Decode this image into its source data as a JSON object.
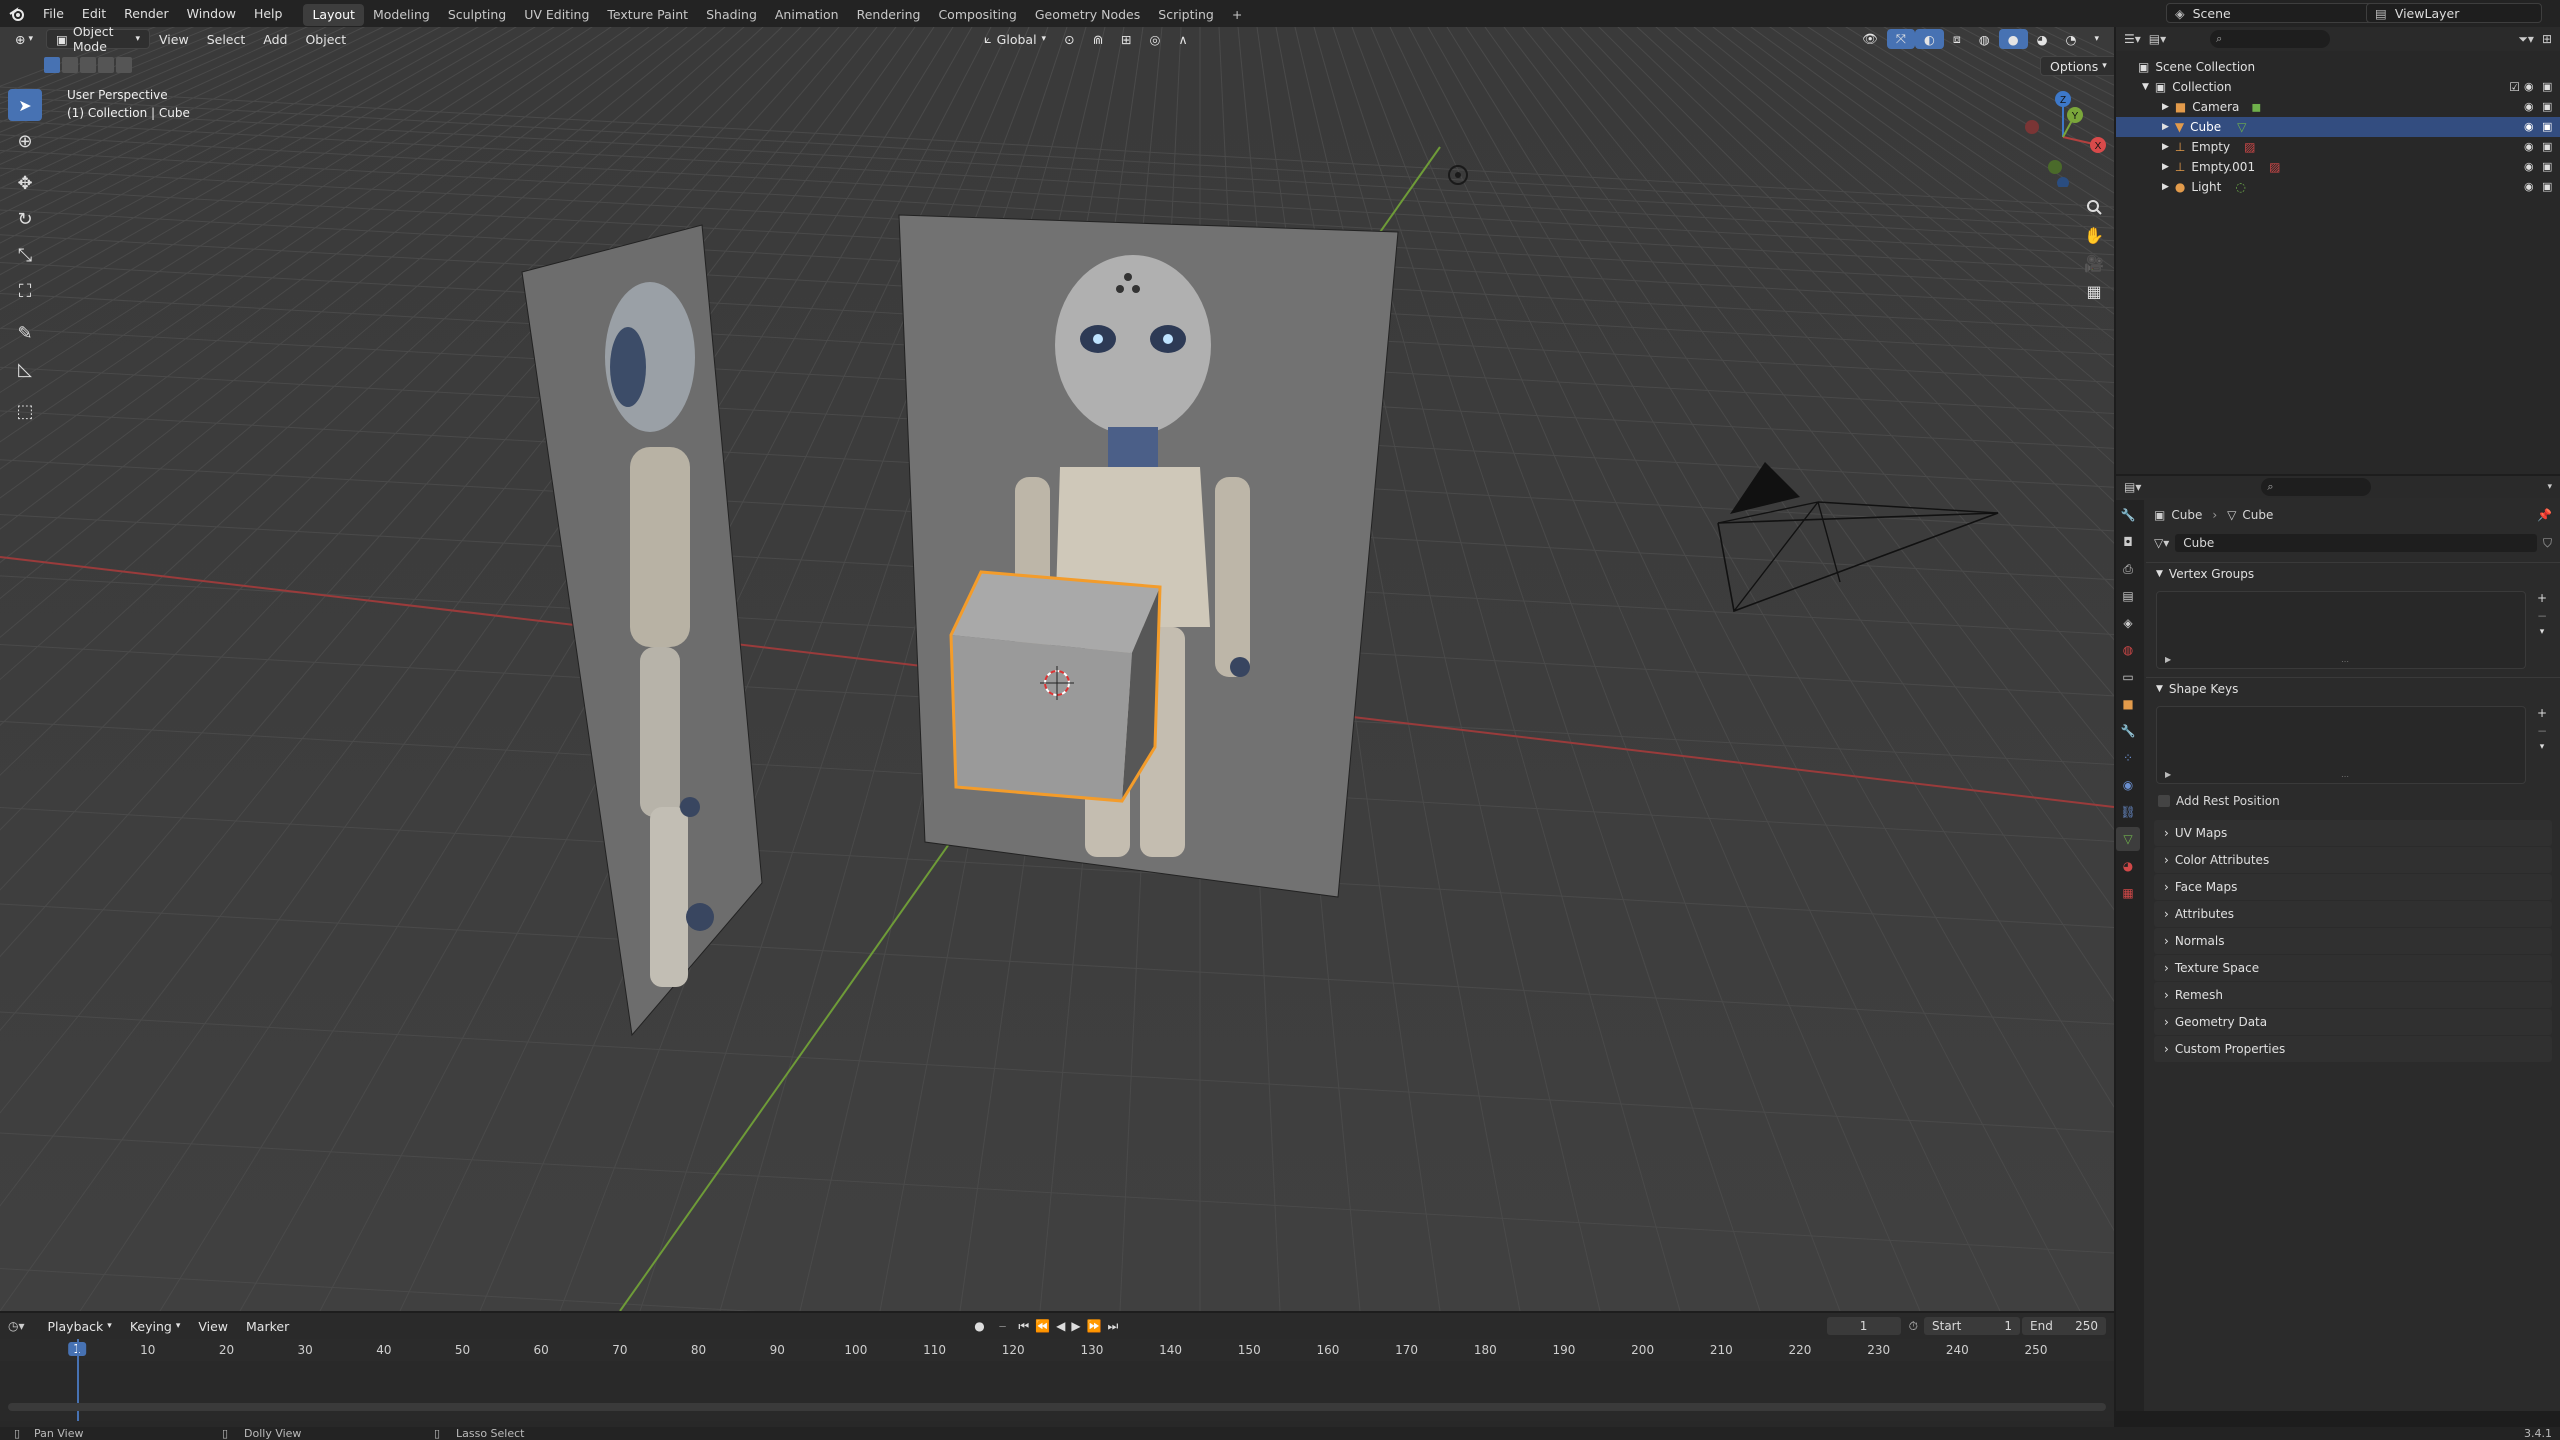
{
  "topbar": {
    "menus": [
      "File",
      "Edit",
      "Render",
      "Window",
      "Help"
    ],
    "workspaces": [
      "Layout",
      "Modeling",
      "Sculpting",
      "UV Editing",
      "Texture Paint",
      "Shading",
      "Animation",
      "Rendering",
      "Compositing",
      "Geometry Nodes",
      "Scripting"
    ],
    "active_workspace": "Layout",
    "add_tab": "+",
    "scene": "Scene",
    "view_layer": "ViewLayer"
  },
  "viewport": {
    "mode": "Object Mode",
    "menus": [
      "View",
      "Select",
      "Add",
      "Object"
    ],
    "orientation": "Global",
    "options": "Options",
    "perspective": "User Perspective",
    "active_info": "(1) Collection | Cube",
    "gizmo": {
      "x": "X",
      "y": "Y",
      "z": "Z"
    }
  },
  "outliner": {
    "scene_collection": "Scene Collection",
    "collection": "Collection",
    "items": [
      "Camera",
      "Cube",
      "Empty",
      "Empty.001",
      "Light"
    ],
    "selected": "Cube"
  },
  "properties": {
    "breadcrumb_object": "Cube",
    "breadcrumb_data": "Cube",
    "mesh_name": "Cube",
    "panels_open": [
      "Vertex Groups",
      "Shape Keys"
    ],
    "add_rest_position": "Add Rest Position",
    "panels_closed": [
      "UV Maps",
      "Color Attributes",
      "Face Maps",
      "Attributes",
      "Normals",
      "Texture Space",
      "Remesh",
      "Geometry Data",
      "Custom Properties"
    ]
  },
  "timeline": {
    "menus": [
      "Playback",
      "Keying",
      "View",
      "Marker"
    ],
    "current_frame": "1",
    "start_label": "Start",
    "start": "1",
    "end_label": "End",
    "end": "250",
    "ticks": [
      "1",
      "10",
      "20",
      "30",
      "40",
      "50",
      "60",
      "70",
      "80",
      "90",
      "100",
      "110",
      "120",
      "130",
      "140",
      "150",
      "160",
      "170",
      "180",
      "190",
      "200",
      "210",
      "220",
      "230",
      "240",
      "250"
    ]
  },
  "statusbar": {
    "hints": [
      "Pan View",
      "Dolly View",
      "Lasso Select"
    ],
    "version": "3.4.1"
  },
  "colors": {
    "accent": "#4772b3",
    "selection_outline": "#f39c2b",
    "x_axis": "#b2403e",
    "y_axis": "#7aa63a",
    "z_axis": "#3d78c9"
  }
}
